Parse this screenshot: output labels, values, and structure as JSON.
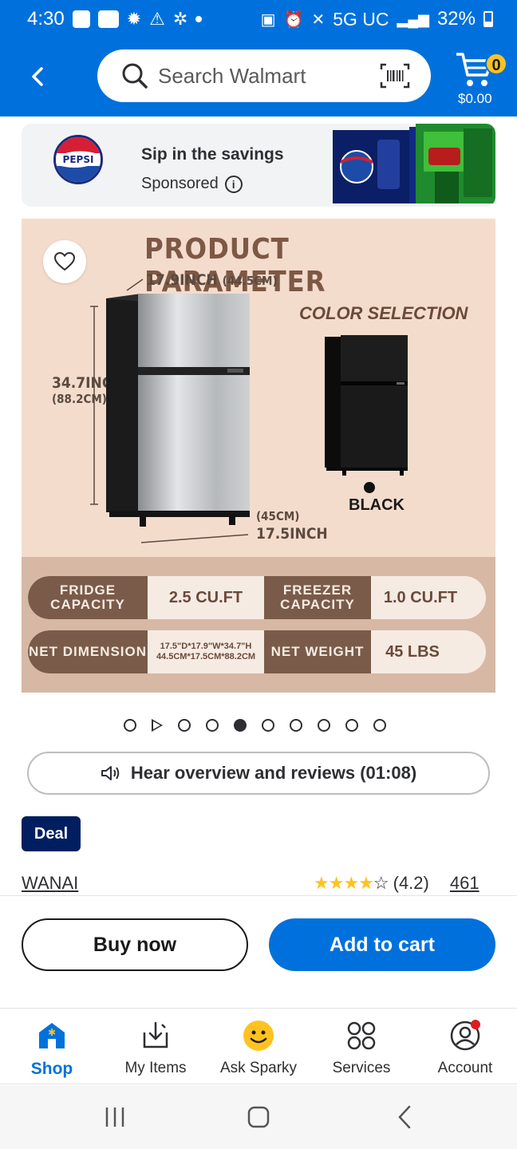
{
  "status_bar": {
    "time": "4:30",
    "network": "5G UC",
    "battery": "32%"
  },
  "header": {
    "search_placeholder": "Search Walmart",
    "cart_count": "0",
    "cart_total": "$0.00"
  },
  "sponsored_ad": {
    "brand_logo_text": "PEPSI",
    "title": "Sip in the savings",
    "label": "Sponsored"
  },
  "product_image": {
    "title": "PRODUCT PARAMETER",
    "width_label_main": "17.9INCH",
    "width_label_metric": "(44.5CM)",
    "height_label_main": "34.7INCH",
    "height_label_metric": "(88.2CM)",
    "depth_label_metric": "(45CM)",
    "depth_label_main": "17.5INCH",
    "color_selection": "COLOR SELECTION",
    "color_name": "BLACK",
    "specs": [
      {
        "label": "FRIDGE CAPACITY",
        "value": "2.5 CU.FT"
      },
      {
        "label": "FREEZER CAPACITY",
        "value": "1.0 CU.FT"
      },
      {
        "label": "NET DIMENSION",
        "value": "17.5\"D*17.9\"W*34.7\"H 44.5CM*17.5CM*88.2CM"
      },
      {
        "label": "NET WEIGHT",
        "value": "45 LBS"
      }
    ],
    "carousel_total": 10,
    "carousel_active_index": 4
  },
  "overview_button": {
    "label": "Hear overview and reviews (01:08)"
  },
  "product_info": {
    "deal_badge": "Deal",
    "brand": "WANAI",
    "rating_text": "(4.2)",
    "rating_value": 4.2,
    "review_count": "461"
  },
  "actions": {
    "buy_now": "Buy now",
    "add_to_cart": "Add to cart"
  },
  "tabs": [
    {
      "label": "Shop",
      "active": true
    },
    {
      "label": "My Items",
      "active": false
    },
    {
      "label": "Ask Sparky",
      "active": false
    },
    {
      "label": "Services",
      "active": false
    },
    {
      "label": "Account",
      "active": false
    }
  ],
  "colors": {
    "brand_blue": "#0071dc",
    "spark_yellow": "#ffc220",
    "deal_navy": "#001e60",
    "notification_red": "#de1c24"
  }
}
